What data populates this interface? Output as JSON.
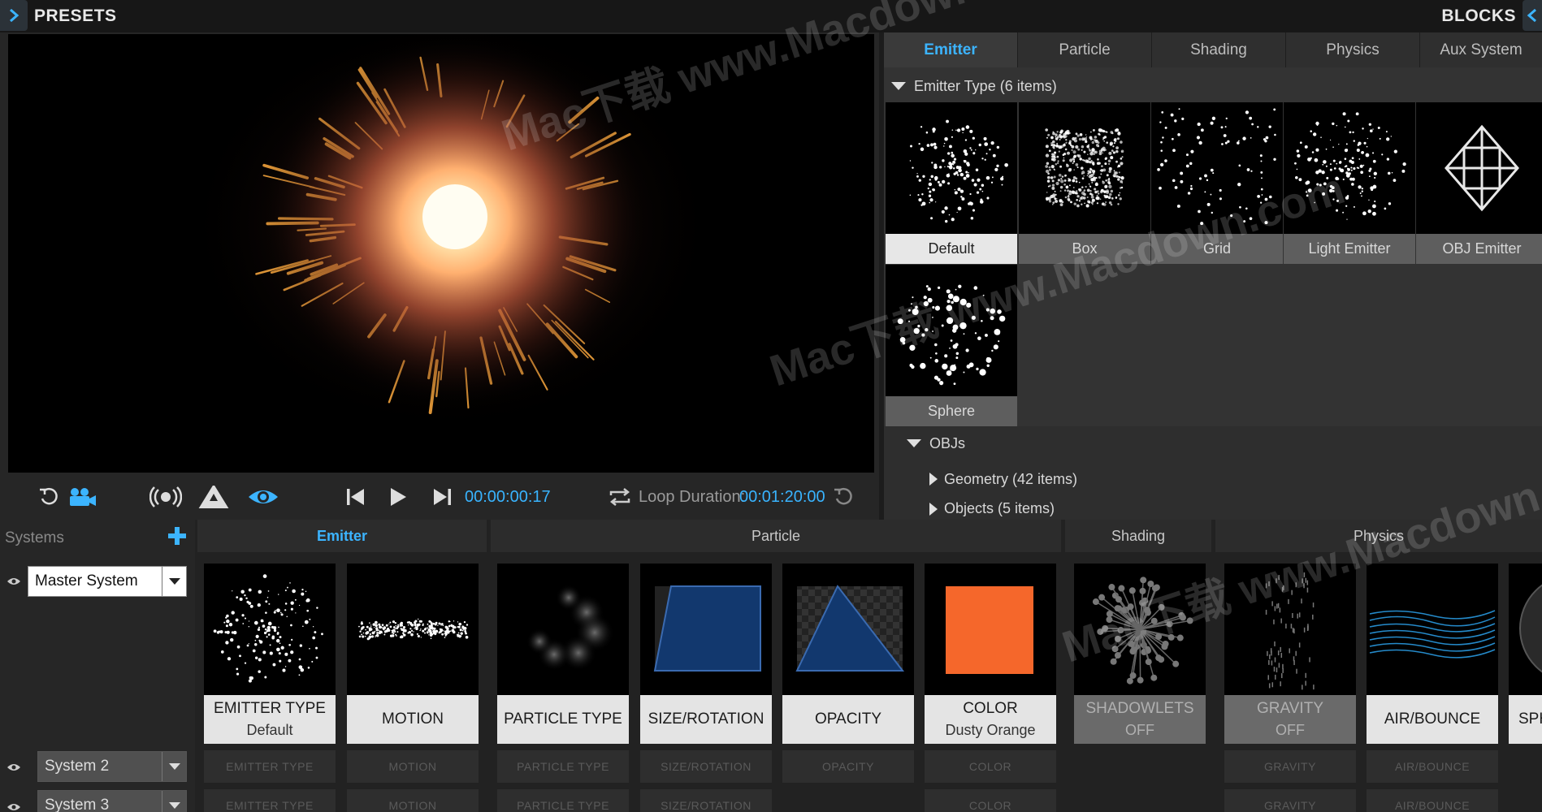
{
  "topbar": {
    "left_title": "PRESETS",
    "right_title": "BLOCKS"
  },
  "transport": {
    "current_time": "00:00:00:17",
    "loop_label": "Loop Duration:",
    "loop_duration": "00:01:20:00"
  },
  "right_panel": {
    "tabs": [
      "Emitter",
      "Particle",
      "Shading",
      "Physics",
      "Aux System"
    ],
    "active_tab": "Emitter",
    "emitter_type_header": "Emitter Type  (6 items)",
    "emitter_types": [
      "Default",
      "Box",
      "Grid",
      "Light Emitter",
      "OBJ Emitter",
      "Sphere"
    ],
    "selected_emitter": "Default",
    "objs_header": "OBJs",
    "geometry_header": "Geometry  (42 items)",
    "objects_header": "Objects  (5 items)"
  },
  "systems": {
    "header": "Systems",
    "master": "Master System",
    "system2": "System  2",
    "system3": "System  3"
  },
  "categories": [
    "Emitter",
    "Particle",
    "Shading",
    "Physics"
  ],
  "blocks": [
    {
      "title": "EMITTER TYPE",
      "sub": "Default"
    },
    {
      "title": "MOTION",
      "sub": ""
    },
    {
      "title": "PARTICLE TYPE",
      "sub": ""
    },
    {
      "title": "SIZE/ROTATION",
      "sub": ""
    },
    {
      "title": "OPACITY",
      "sub": ""
    },
    {
      "title": "COLOR",
      "sub": "Dusty Orange"
    },
    {
      "title": "SHADOWLETS",
      "sub": "OFF"
    },
    {
      "title": "GRAVITY",
      "sub": "OFF"
    },
    {
      "title": "AIR/BOUNCE",
      "sub": ""
    },
    {
      "title": "SPH",
      "sub": ""
    }
  ],
  "ghost_rows": {
    "row1": [
      "EMITTER TYPE",
      "MOTION",
      "PARTICLE TYPE",
      "SIZE/ROTATION",
      "OPACITY",
      "COLOR",
      "GRAVITY",
      "AIR/BOUNCE"
    ],
    "row2": [
      "EMITTER TYPE",
      "MOTION",
      "PARTICLE TYPE",
      "SIZE/ROTATION",
      "",
      "COLOR",
      "GRAVITY",
      "AIR/BOUNCE"
    ]
  },
  "colors": {
    "accent": "#3cb4ff",
    "size_rotation_fill": "#12386e",
    "color_swatch": "#f5672b"
  },
  "watermark": "Mac下载 www.Macdown.com"
}
